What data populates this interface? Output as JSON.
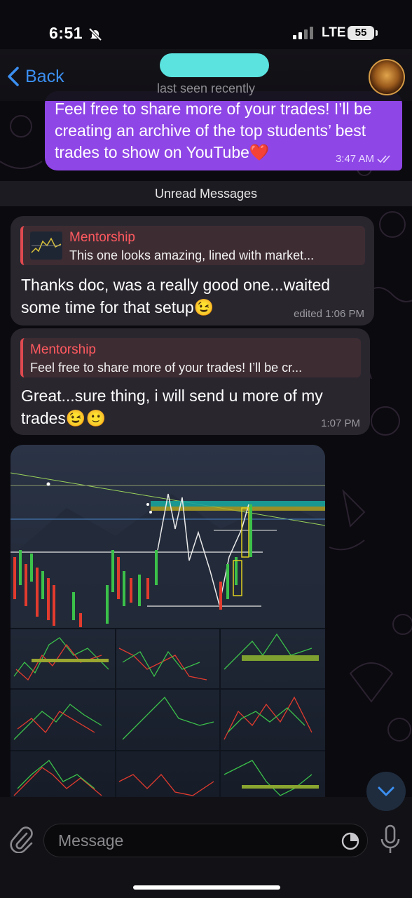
{
  "status": {
    "time": "6:51",
    "network": "LTE",
    "battery": "55"
  },
  "header": {
    "back_label": "Back",
    "subtitle": "last seen recently"
  },
  "messages": {
    "outgoing": {
      "text": "Feel free to share more of your trades! I’ll be creating an archive of the top students’ best trades to show on YouTube❤️",
      "time": "3:47 AM"
    },
    "divider": "Unread Messages",
    "incoming1": {
      "reply_name": "Mentorship",
      "reply_text": "This one looks amazing, lined with market...",
      "text": "Thanks doc, was a really good one...waited some time for that setup😉",
      "time": "edited 1:06 PM"
    },
    "incoming2": {
      "reply_name": "Mentorship",
      "reply_text": "Feel free to share more of your trades! I’ll be cr...",
      "text": "Great...sure thing, i will send u more of my trades😉🙂",
      "time": "1:07 PM"
    }
  },
  "composer": {
    "placeholder": "Message"
  },
  "colors": {
    "accent": "#3b8ff1",
    "outgoing": "#8f46e6",
    "reply_accent": "#ff5a5f"
  }
}
